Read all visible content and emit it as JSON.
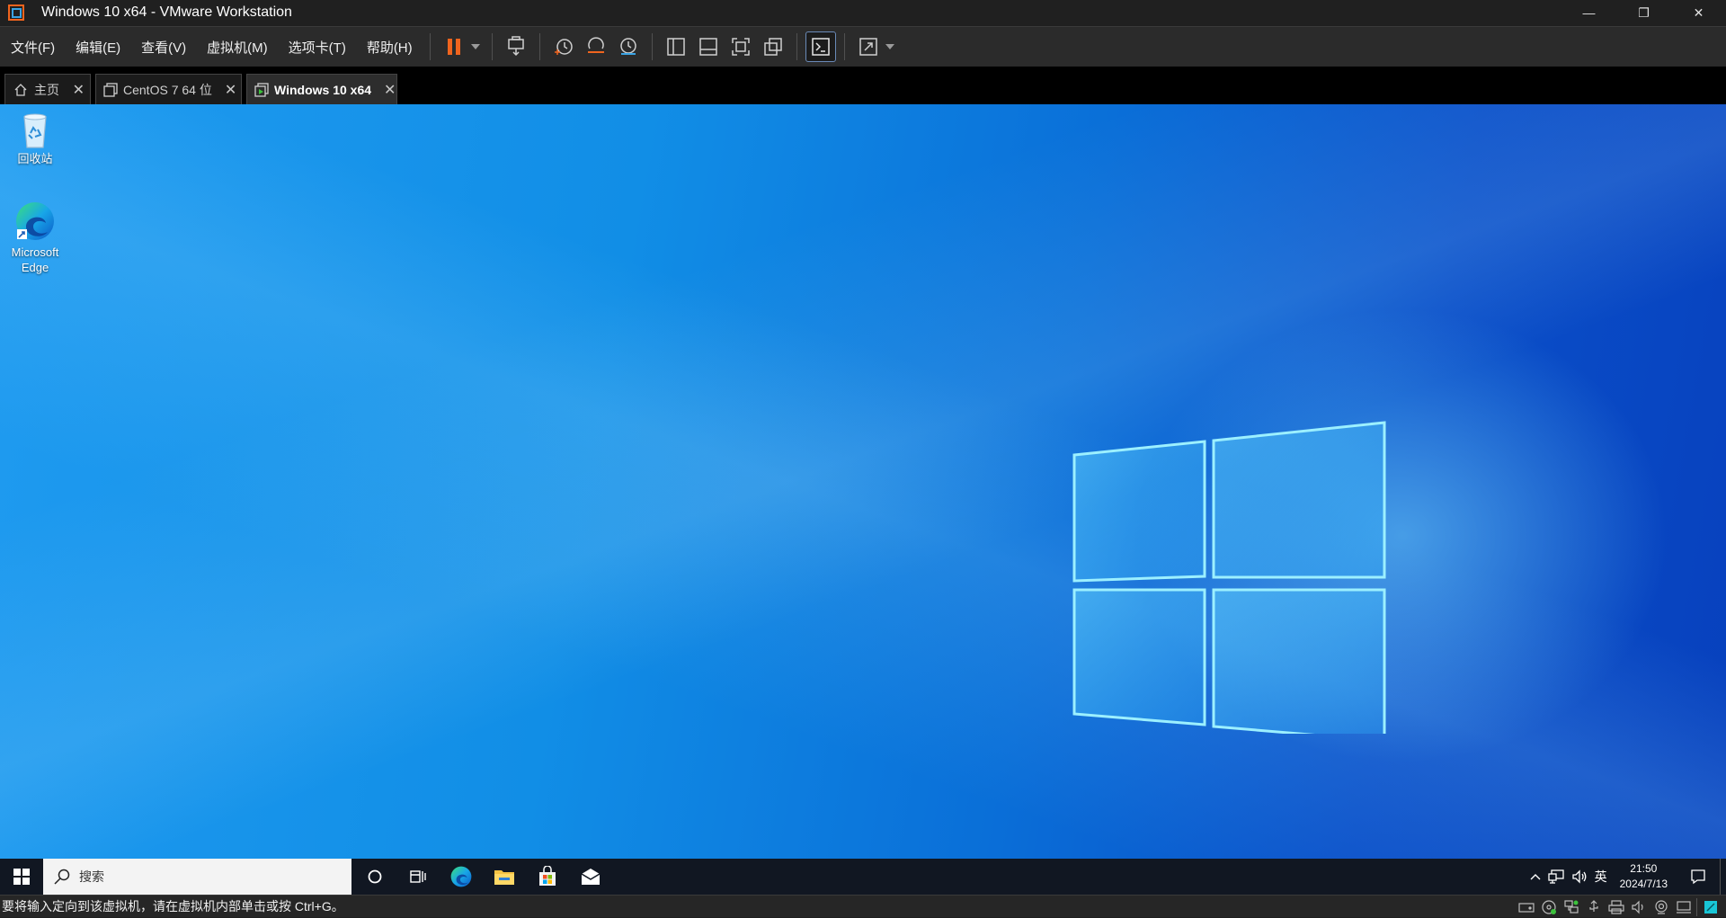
{
  "window": {
    "title": "Windows 10 x64 - VMware Workstation",
    "minimize_glyph": "—",
    "restore_glyph": "❐",
    "close_glyph": "✕"
  },
  "menu": {
    "items": [
      {
        "label": "文件(F)"
      },
      {
        "label": "编辑(E)"
      },
      {
        "label": "查看(V)"
      },
      {
        "label": "虚拟机(M)"
      },
      {
        "label": "选项卡(T)"
      },
      {
        "label": "帮助(H)"
      }
    ]
  },
  "toolbar": {
    "icons": [
      "pause-icon",
      "send-ctrl-alt-del-icon",
      "snapshot-icon",
      "revert-snapshot-icon",
      "snapshot-manager-icon",
      "show-library-icon",
      "thumbnail-bar-icon",
      "full-screen-icon",
      "unity-icon",
      "console-view-icon",
      "stretch-guest-icon"
    ],
    "accent_color": "#f0641e"
  },
  "tabs": [
    {
      "label": "主页",
      "close": "✕",
      "icon": "home-icon"
    },
    {
      "label": "CentOS 7 64 位",
      "close": "✕",
      "icon": "vm-icon"
    },
    {
      "label": "Windows 10 x64",
      "close": "✕",
      "icon": "vm-running-icon",
      "active": true
    }
  ],
  "desktop": {
    "icons": [
      {
        "label": "回收站",
        "icon": "recycle-bin-icon"
      },
      {
        "label": "Microsoft Edge",
        "icon": "edge-icon"
      }
    ],
    "background_colors": [
      "#1f9bf0",
      "#0a4fc9"
    ]
  },
  "taskbar": {
    "search_placeholder": "搜索",
    "tray": {
      "ime": "英",
      "time": "21:50",
      "date": "2024/7/13"
    }
  },
  "statusbar": {
    "message": "要将输入定向到该虚拟机，请在虚拟机内部单击或按 Ctrl+G。"
  }
}
